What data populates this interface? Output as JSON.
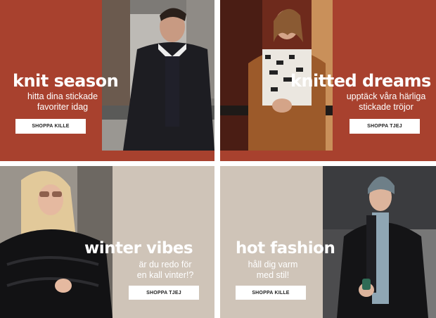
{
  "banners": [
    {
      "headline": "knit season",
      "sub_line1": "hitta dina stickade",
      "sub_line2": "favoriter idag",
      "button": "SHOPPA KILLE"
    },
    {
      "headline": "knitted dreams",
      "sub_line1": "upptäck våra härliga",
      "sub_line2": "stickade tröjor",
      "button": "SHOPPA TJEJ"
    },
    {
      "headline": "winter vibes",
      "sub_line1": "är du redo för",
      "sub_line2": "en kall vinter!?",
      "button": "SHOPPA TJEJ"
    },
    {
      "headline": "hot fashion",
      "sub_line1": "håll dig varm",
      "sub_line2": "med stil!",
      "button": "SHOPPA KILLE"
    }
  ],
  "colors": {
    "rust": "#a8412e",
    "taupe": "#cfc4b8"
  }
}
